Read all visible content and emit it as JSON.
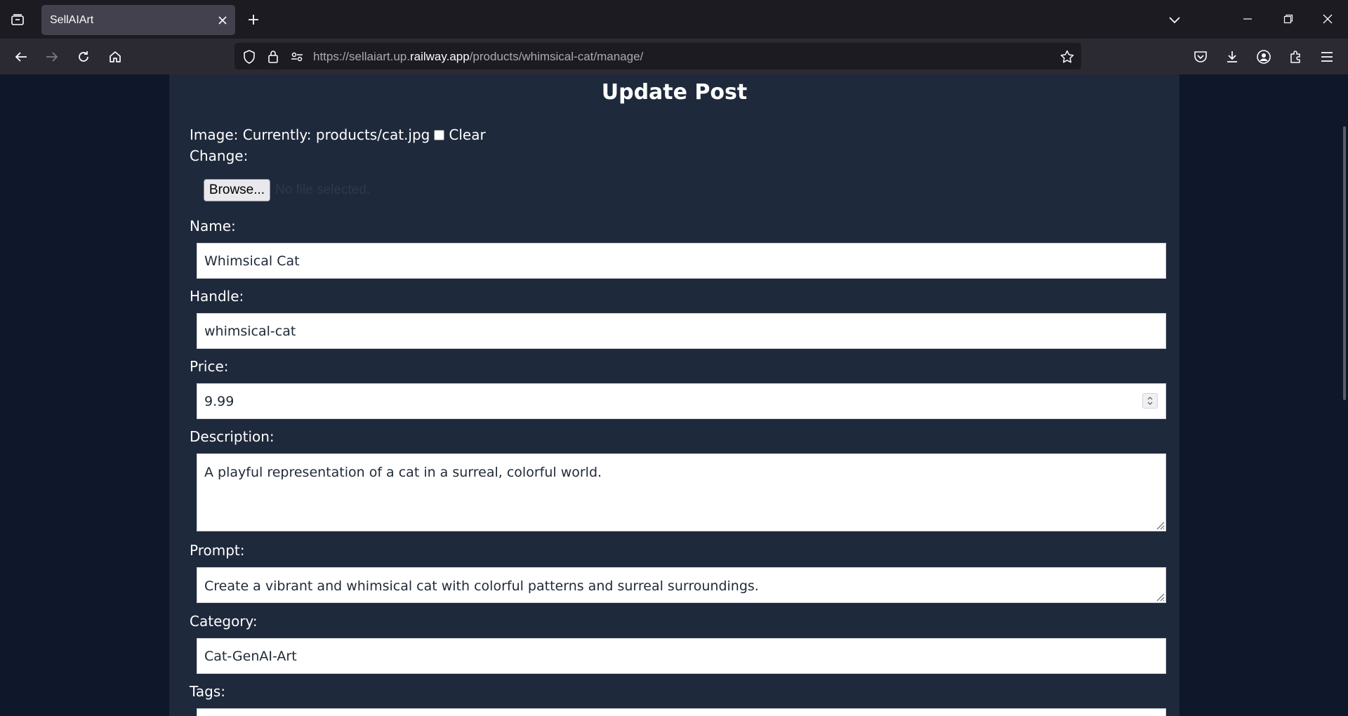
{
  "browser": {
    "tab_title": "SellAIArt",
    "url_prefix": "https://sellaiart.up.",
    "url_host": "railway.app",
    "url_path": "/products/whimsical-cat/manage/"
  },
  "page": {
    "title": "Update Post"
  },
  "form": {
    "image": {
      "label": "Image:",
      "currently_text": "Currently: products/cat.jpg",
      "clear_label": "Clear",
      "change_label": "Change:",
      "browse_label": "Browse...",
      "no_file_text": "No file selected."
    },
    "name": {
      "label": "Name:",
      "value": "Whimsical Cat"
    },
    "handle": {
      "label": "Handle:",
      "value": "whimsical-cat"
    },
    "price": {
      "label": "Price:",
      "value": "9.99"
    },
    "description": {
      "label": "Description:",
      "value": "A playful representation of a cat in a surreal, colorful world."
    },
    "prompt": {
      "label": "Prompt:",
      "value": "Create a vibrant and whimsical cat with colorful patterns and surreal surroundings."
    },
    "category": {
      "label": "Category:",
      "value": "Cat-GenAI-Art"
    },
    "tags": {
      "label": "Tags:",
      "value": ""
    }
  },
  "colors": {
    "page_bg": "#0f172a",
    "panel_bg": "#1e293b",
    "browser_bg": "#2b2a33"
  }
}
